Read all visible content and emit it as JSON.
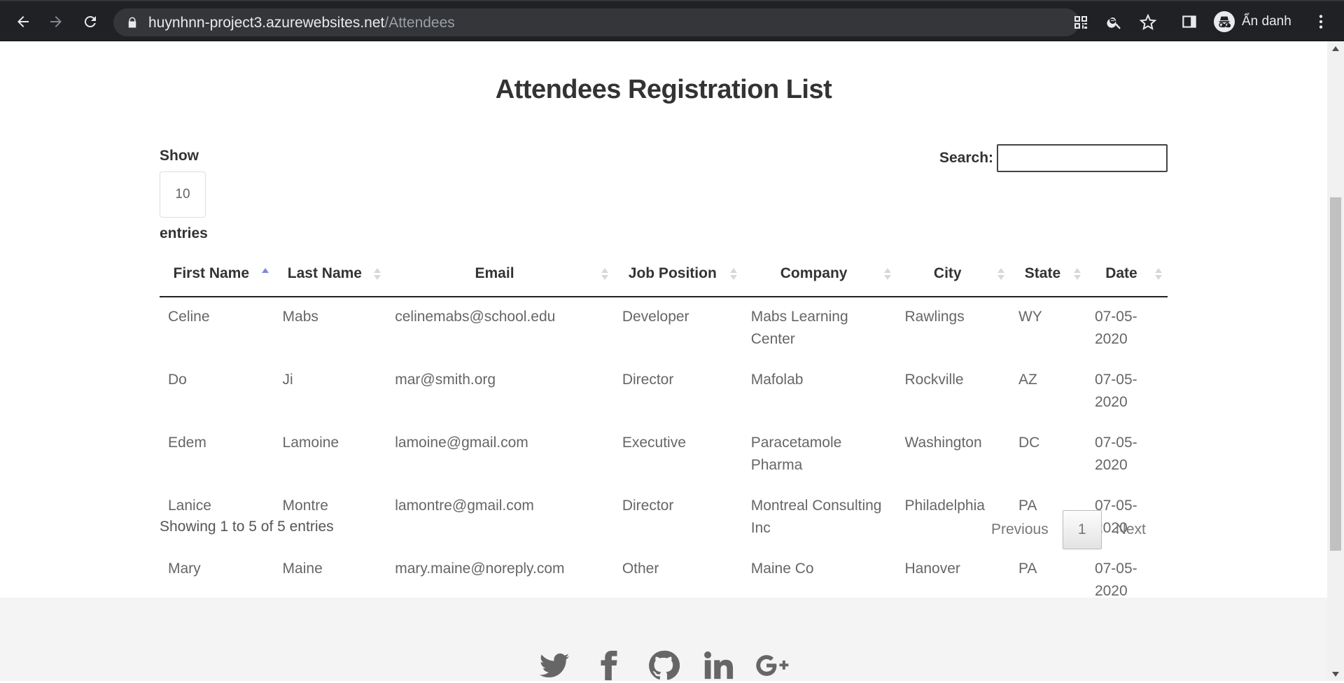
{
  "browser": {
    "url_host": "huynhnn-project3.azurewebsites.net",
    "url_path": "/Attendees",
    "profile_label": "Ẩn danh"
  },
  "page": {
    "title": "Attendees Registration List",
    "length_show_label": "Show",
    "length_value": "10",
    "length_entries_label": "entries",
    "search_label": "Search:",
    "search_value": ""
  },
  "table": {
    "columns": [
      "First Name",
      "Last Name",
      "Email",
      "Job Position",
      "Company",
      "City",
      "State",
      "Date"
    ],
    "sorted_column": "First Name",
    "sort_direction": "ascending",
    "rows": [
      [
        "Celine",
        "Mabs",
        "celinemabs@school.edu",
        "Developer",
        "Mabs Learning Center",
        "Rawlings",
        "WY",
        "07-05-2020"
      ],
      [
        "Do",
        "Ji",
        "mar@smith.org",
        "Director",
        "Mafolab",
        "Rockville",
        "AZ",
        "07-05-2020"
      ],
      [
        "Edem",
        "Lamoine",
        "lamoine@gmail.com",
        "Executive",
        "Paracetamole Pharma",
        "Washington",
        "DC",
        "07-05-2020"
      ],
      [
        "Lanice",
        "Montre",
        "lamontre@gmail.com",
        "Director",
        "Montreal Consulting Inc",
        "Philadelphia",
        "PA",
        "07-05-2020"
      ],
      [
        "Mary",
        "Maine",
        "mary.maine@noreply.com",
        "Other",
        "Maine Co",
        "Hanover",
        "PA",
        "07-05-2020"
      ]
    ]
  },
  "footer_info": {
    "showing": "Showing 1 to 5 of 5 entries",
    "previous": "Previous",
    "current_page": "1",
    "next": "Next"
  },
  "social_icons": [
    "twitter-icon",
    "facebook-icon",
    "github-icon",
    "linkedin-icon",
    "google-plus-icon"
  ],
  "colors": {
    "chrome_bg": "#202124",
    "sort_active": "#7b8ad6",
    "footer_bg": "#f4f4f4",
    "social_icon": "#666666"
  }
}
